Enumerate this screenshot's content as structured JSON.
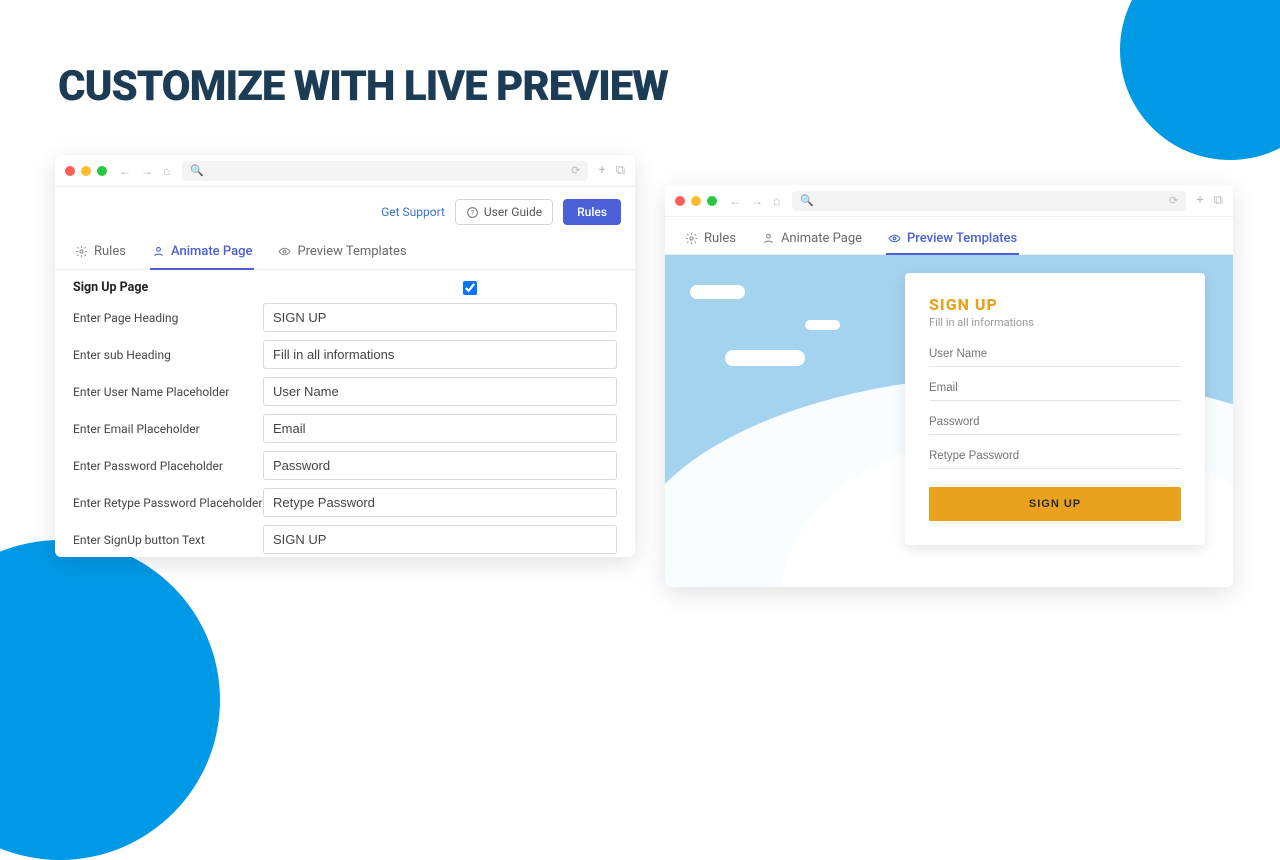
{
  "hero": {
    "title": "CUSTOMIZE WITH LIVE PREVIEW"
  },
  "windowA": {
    "top_actions": {
      "support": "Get Support",
      "user_guide": "User Guide",
      "rules_btn": "Rules"
    },
    "tabs": {
      "rules": "Rules",
      "animate": "Animate Page",
      "preview": "Preview Templates"
    },
    "form": {
      "section_title": "Sign Up Page",
      "labels": {
        "heading": "Enter Page Heading",
        "subheading": "Enter sub Heading",
        "username_ph": "Enter User Name Placeholder",
        "email_ph": "Enter Email Placeholder",
        "password_ph": "Enter Password Placeholder",
        "retype_ph": "Enter Retype Password Placeholder",
        "button_text": "Enter SignUp button Text"
      },
      "values": {
        "heading": "SIGN UP",
        "subheading": "Fill in all informations",
        "username_ph": "User Name",
        "email_ph": "Email",
        "password_ph": "Password",
        "retype_ph": "Retype Password",
        "button_text": "SIGN UP"
      }
    }
  },
  "windowB": {
    "tabs": {
      "rules": "Rules",
      "animate": "Animate Page",
      "preview": "Preview Templates"
    },
    "card": {
      "title": "SIGN UP",
      "sub": "Fill in all informations",
      "fields": {
        "username": "User Name",
        "email": "Email",
        "password": "Password",
        "retype": "Retype Password"
      },
      "button": "SIGN UP"
    }
  }
}
